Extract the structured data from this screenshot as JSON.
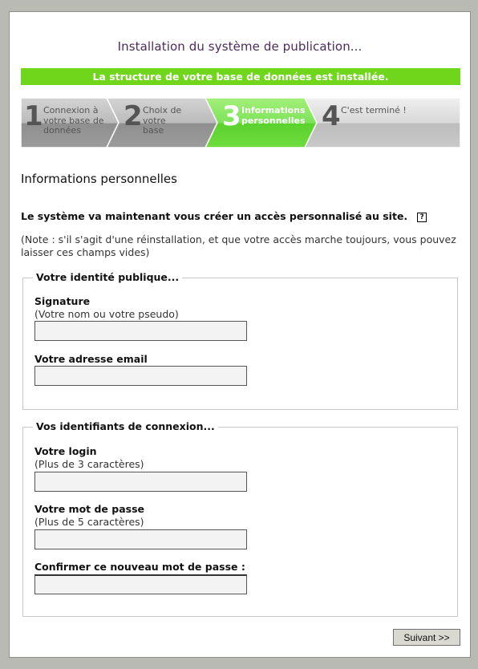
{
  "header": {
    "title": "Installation du système de publication..."
  },
  "status": {
    "message": "La structure de votre base de données est installée."
  },
  "steps": [
    {
      "num": "1",
      "label_line1": "Connexion à",
      "label_line2": "votre base de",
      "label_line3": "données"
    },
    {
      "num": "2",
      "label_line1": "Choix de votre",
      "label_line2": "base"
    },
    {
      "num": "3",
      "label_line1": "Informations",
      "label_line2": "personnelles"
    },
    {
      "num": "4",
      "label_line1": "C'est terminé !"
    }
  ],
  "colors": {
    "accent_green": "#6fd61b",
    "title_purple": "#4e2a5e"
  },
  "section": {
    "title": "Informations personnelles"
  },
  "intro": {
    "text": "Le système va maintenant vous créer un accès personnalisé au site.",
    "help_icon": "?"
  },
  "note": {
    "line1": "(Note : s'il s'agit d'une réinstallation, et que votre accès marche toujours, vous pouvez",
    "line2": "laisser ces champs vides)"
  },
  "identity": {
    "legend": "Votre identité publique...",
    "signature_label": "Signature",
    "signature_hint": "(Votre nom ou votre pseudo)",
    "signature_value": "",
    "email_label": "Votre adresse email",
    "email_value": ""
  },
  "credentials": {
    "legend": "Vos identifiants de connexion...",
    "login_label": "Votre login",
    "login_hint": "(Plus de 3 caractères)",
    "login_value": "",
    "password_label": "Votre mot de passe",
    "password_hint": "(Plus de 5 caractères)",
    "password_value": "",
    "confirm_label": "Confirmer ce nouveau mot de passe :",
    "confirm_value": ""
  },
  "actions": {
    "next_label": "Suivant >>"
  }
}
